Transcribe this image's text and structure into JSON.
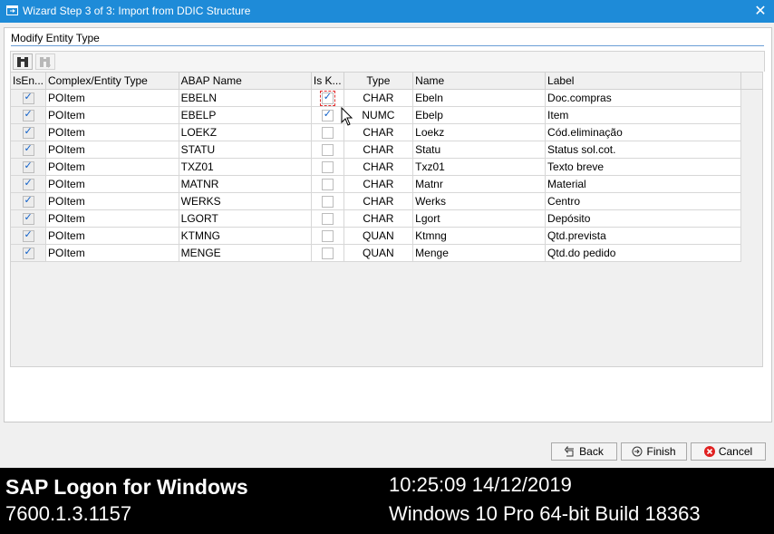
{
  "window": {
    "title": "Wizard Step 3 of 3: Import from DDIC Structure",
    "close_symbol": "✕"
  },
  "section": {
    "title": "Modify Entity Type"
  },
  "table": {
    "headers": [
      "IsEn...",
      "Complex/Entity Type",
      "ABAP Name",
      "Is K...",
      "Type",
      "Name",
      "Label"
    ],
    "rows": [
      {
        "is_entity": true,
        "complex_type": "POItem",
        "abap_name": "EBELN",
        "is_key": true,
        "type": "CHAR",
        "name": "Ebeln",
        "label": "Doc.compras"
      },
      {
        "is_entity": true,
        "complex_type": "POItem",
        "abap_name": "EBELP",
        "is_key": true,
        "type": "NUMC",
        "name": "Ebelp",
        "label": "Item"
      },
      {
        "is_entity": true,
        "complex_type": "POItem",
        "abap_name": "LOEKZ",
        "is_key": false,
        "type": "CHAR",
        "name": "Loekz",
        "label": "Cód.eliminação"
      },
      {
        "is_entity": true,
        "complex_type": "POItem",
        "abap_name": "STATU",
        "is_key": false,
        "type": "CHAR",
        "name": "Statu",
        "label": "Status sol.cot."
      },
      {
        "is_entity": true,
        "complex_type": "POItem",
        "abap_name": "TXZ01",
        "is_key": false,
        "type": "CHAR",
        "name": "Txz01",
        "label": "Texto breve"
      },
      {
        "is_entity": true,
        "complex_type": "POItem",
        "abap_name": "MATNR",
        "is_key": false,
        "type": "CHAR",
        "name": "Matnr",
        "label": "Material"
      },
      {
        "is_entity": true,
        "complex_type": "POItem",
        "abap_name": "WERKS",
        "is_key": false,
        "type": "CHAR",
        "name": "Werks",
        "label": "Centro"
      },
      {
        "is_entity": true,
        "complex_type": "POItem",
        "abap_name": "LGORT",
        "is_key": false,
        "type": "CHAR",
        "name": "Lgort",
        "label": "Depósito"
      },
      {
        "is_entity": true,
        "complex_type": "POItem",
        "abap_name": "KTMNG",
        "is_key": false,
        "type": "QUAN",
        "name": "Ktmng",
        "label": "Qtd.prevista"
      },
      {
        "is_entity": true,
        "complex_type": "POItem",
        "abap_name": "MENGE",
        "is_key": false,
        "type": "QUAN",
        "name": "Menge",
        "label": "Qtd.do pedido"
      }
    ]
  },
  "buttons": {
    "back": "Back",
    "finish": "Finish",
    "cancel": "Cancel"
  },
  "status_bar": {
    "app_name": "SAP Logon for Windows",
    "version": "7600.1.3.1157",
    "datetime": "10:25:09 14/12/2019",
    "os": "Windows 10 Pro 64-bit Build 18363"
  },
  "colors": {
    "title_bar": "#1e8bd8",
    "accent_line": "#6a9ed6",
    "checkbox_checked": "#1060c8",
    "cancel_icon": "#e02020"
  },
  "icons": {
    "title": "window-icon",
    "toolbar_find": "binoculars-icon",
    "toolbar_find_next": "binoculars-next-icon",
    "back": "back-arrow-icon",
    "finish": "finish-icon",
    "cancel": "cancel-icon"
  },
  "checkbox_symbol": "✓"
}
